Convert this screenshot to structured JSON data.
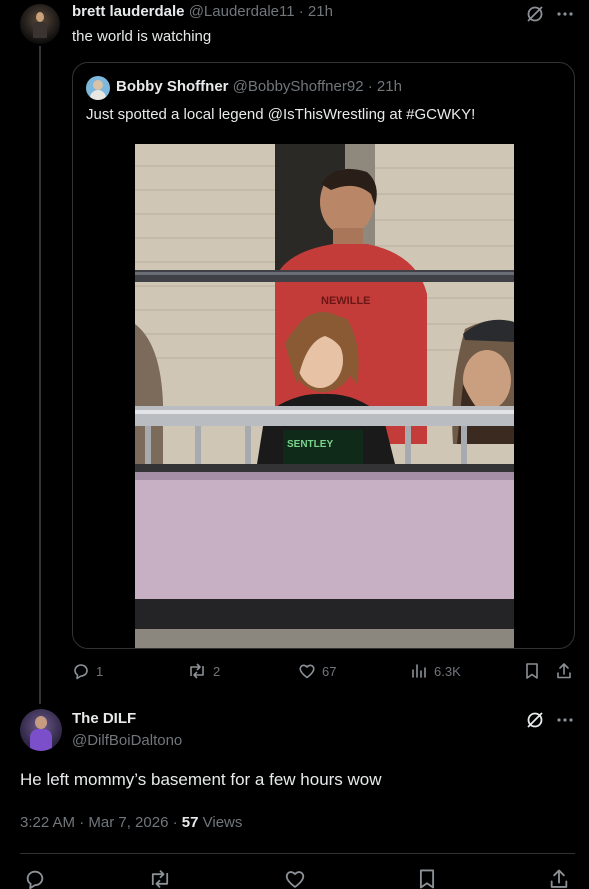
{
  "reply_tweet": {
    "author_name": "brett lauderdale",
    "handle": "@Lauderdale11",
    "separator": "·",
    "time": "21h",
    "text": "the world is watching",
    "quote": {
      "author_name": "Bobby Shoffner",
      "handle": "@BobbyShoffner92",
      "separator": "·",
      "time": "21h",
      "text": "Just spotted a local legend @IsThisWrestling at #GCWKY!"
    },
    "actions": {
      "replies": "1",
      "reposts": "2",
      "likes": "67",
      "views": "6.3K"
    }
  },
  "main_tweet": {
    "author_name": "The DILF",
    "handle": "@DilfBoiDaltono",
    "text": "He left mommy’s basement for a few hours wow",
    "timestamp": "3:22 AM · Mar 7, 2026",
    "separator": "·",
    "views_count": "57",
    "views_label": "Views"
  },
  "colors": {
    "background": "#000000",
    "text_primary": "#e7e9ea",
    "text_secondary": "#71767b",
    "border": "#2f3336"
  },
  "icons": [
    "grok-icon",
    "more-icon",
    "reply-icon",
    "repost-icon",
    "like-icon",
    "views-icon",
    "bookmark-icon",
    "share-icon"
  ]
}
